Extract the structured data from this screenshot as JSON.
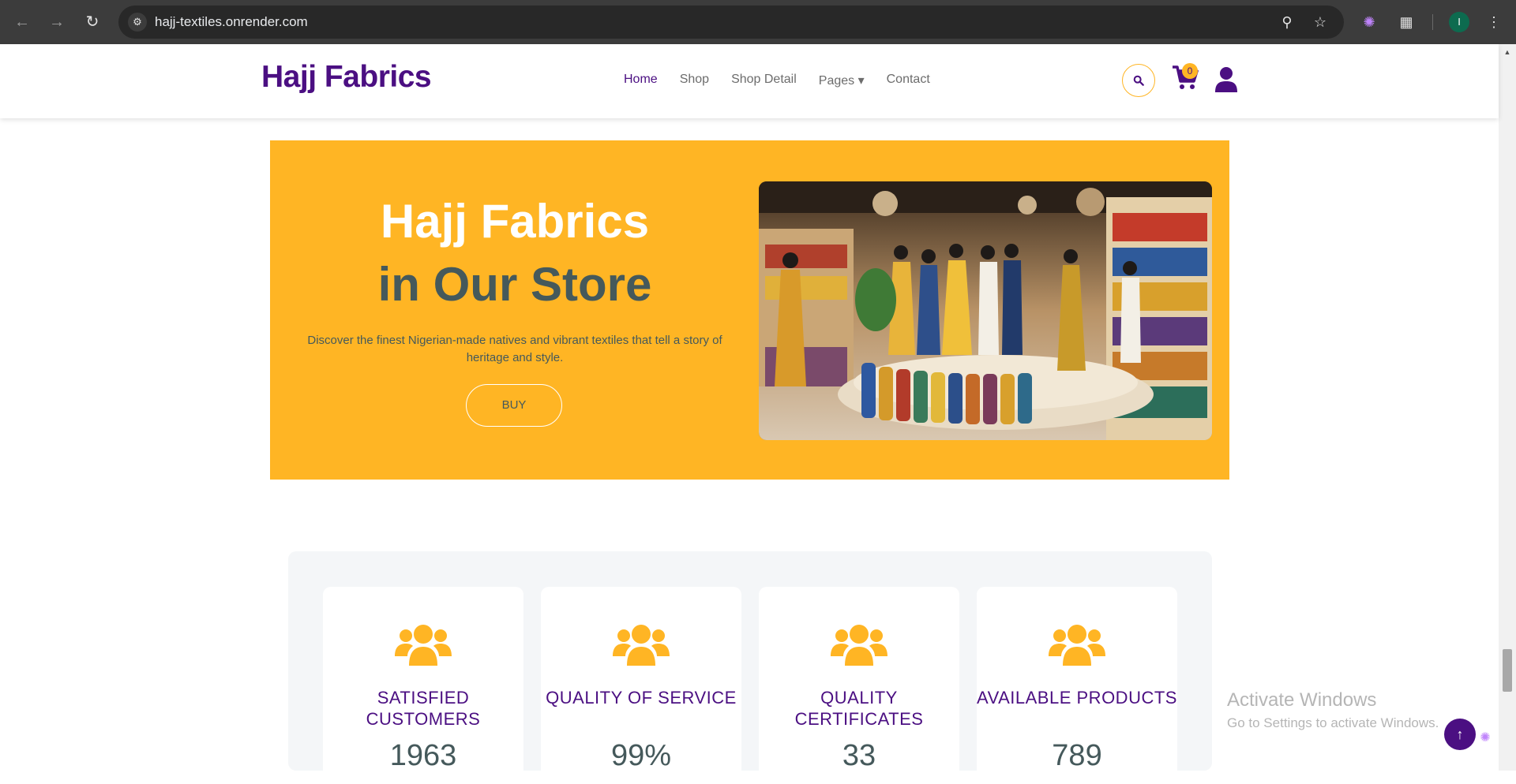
{
  "browser": {
    "url": "hajj-textiles.onrender.com",
    "profile_initial": "I"
  },
  "header": {
    "brand": "Hajj Fabrics",
    "nav": [
      {
        "label": "Home",
        "active": true
      },
      {
        "label": "Shop"
      },
      {
        "label": "Shop Detail"
      },
      {
        "label": "Pages ▾"
      },
      {
        "label": "Contact"
      }
    ],
    "cart_count": "0"
  },
  "hero": {
    "title": "Hajj Fabrics",
    "subtitle": "in Our Store",
    "description": "Discover the finest Nigerian-made natives and vibrant textiles that tell a story of heritage and style.",
    "button": "BUY"
  },
  "stats": [
    {
      "label": "SATISFIED CUSTOMERS",
      "value": "1963"
    },
    {
      "label": "QUALITY OF SERVICE",
      "value": "99%"
    },
    {
      "label": "QUALITY CERTIFICATES",
      "value": "33"
    },
    {
      "label": "AVAILABLE PRODUCTS",
      "value": "789"
    }
  ],
  "watermark": {
    "title": "Activate Windows",
    "subtitle": "Go to Settings to activate Windows."
  },
  "colors": {
    "primary": "#4b0f82",
    "accent": "#ffb524",
    "text": "#45595b"
  }
}
